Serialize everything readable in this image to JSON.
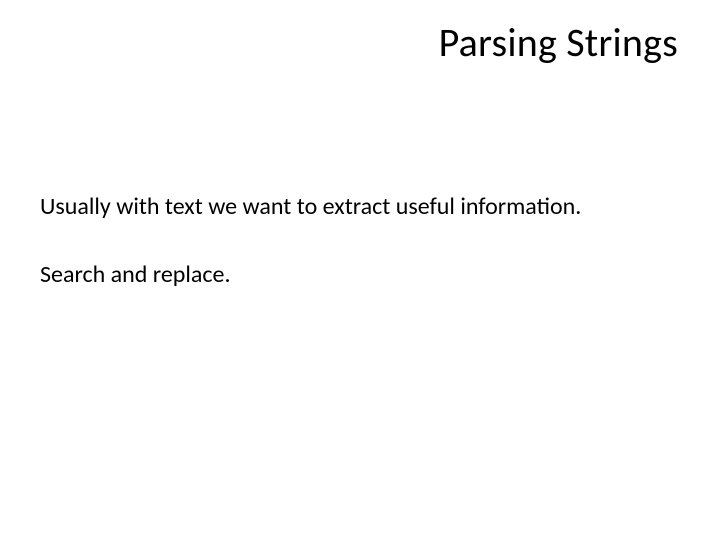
{
  "slide": {
    "title": "Parsing Strings",
    "paragraphs": [
      "Usually with text we want to extract useful information.",
      "Search and replace."
    ]
  }
}
